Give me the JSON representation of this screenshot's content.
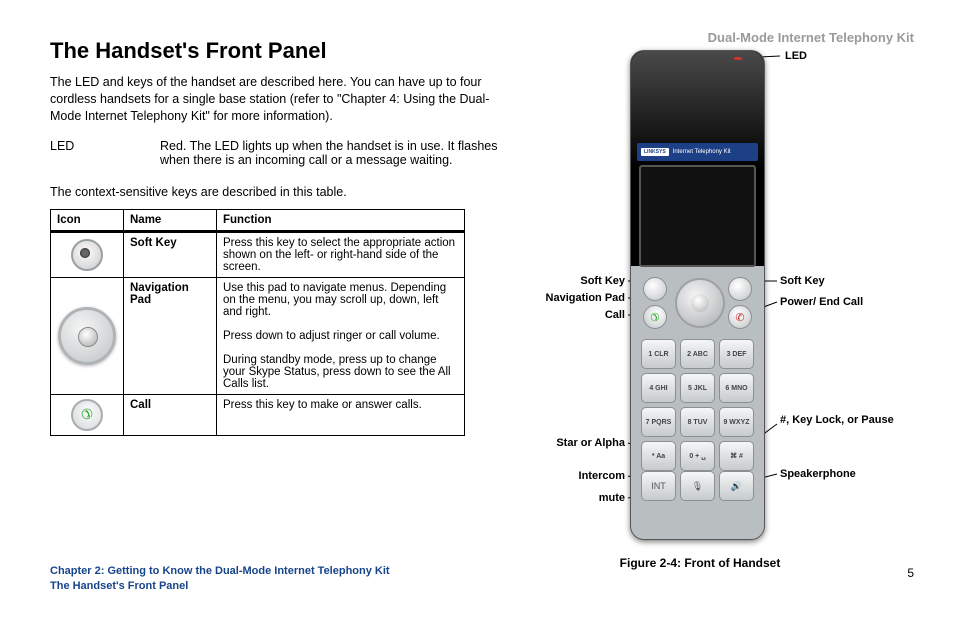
{
  "doc_title": "Dual-Mode Internet Telephony Kit",
  "heading": "The Handset's Front Panel",
  "intro": "The LED and keys of the handset are described here. You can have up to four cordless handsets for a single base station (refer to \"Chapter 4: Using the Dual-Mode Internet Telephony Kit\" for more information).",
  "led": {
    "label": "LED",
    "desc": "Red. The LED lights up when the handset is in use. It flashes when there is an incoming call or a message waiting."
  },
  "context_line": "The context-sensitive keys are described in this table.",
  "table": {
    "headers": {
      "icon": "Icon",
      "name": "Name",
      "function": "Function"
    },
    "rows": [
      {
        "name": "Soft Key",
        "func": "Press this key to select the appropriate action shown on the left- or right-hand side of the screen."
      },
      {
        "name": "Navigation Pad",
        "func": "Use this pad to navigate menus. Depending on the menu, you may scroll up, down, left and right.\n\nPress down to adjust ringer or call volume.\n\nDuring standby mode, press up to change your Skype Status, press down to see the All Calls list."
      },
      {
        "name": "Call",
        "func": "Press this key to make or answer calls."
      }
    ]
  },
  "figure": {
    "caption": "Figure 2-4: Front of Handset",
    "brand_logo": "LINKSYS",
    "brand_text": "Internet Telephony Kit",
    "keypad": [
      "1 CLR",
      "2 ABC",
      "3 DEF",
      "4 GHI",
      "5 JKL",
      "6 MNO",
      "7 PQRS",
      "8 TUV",
      "9 WXYZ",
      "* Aa",
      "0 + ␣",
      "⌘ #"
    ],
    "bottom": [
      "INT",
      "🎙",
      "🔊"
    ],
    "callouts": {
      "led": "LED",
      "softkey_l": "Soft Key",
      "softkey_r": "Soft Key",
      "navpad": "Navigation Pad",
      "call": "Call",
      "power": "Power/ End Call",
      "star": "Star or Alpha",
      "hash": "#, Key Lock, or Pause",
      "intercom": "Intercom",
      "mute": "mute",
      "speaker": "Speakerphone"
    }
  },
  "footer": {
    "line1": "Chapter 2: Getting to Know the Dual-Mode Internet Telephony Kit",
    "line2": "The Handset's Front Panel"
  },
  "page_num": "5"
}
